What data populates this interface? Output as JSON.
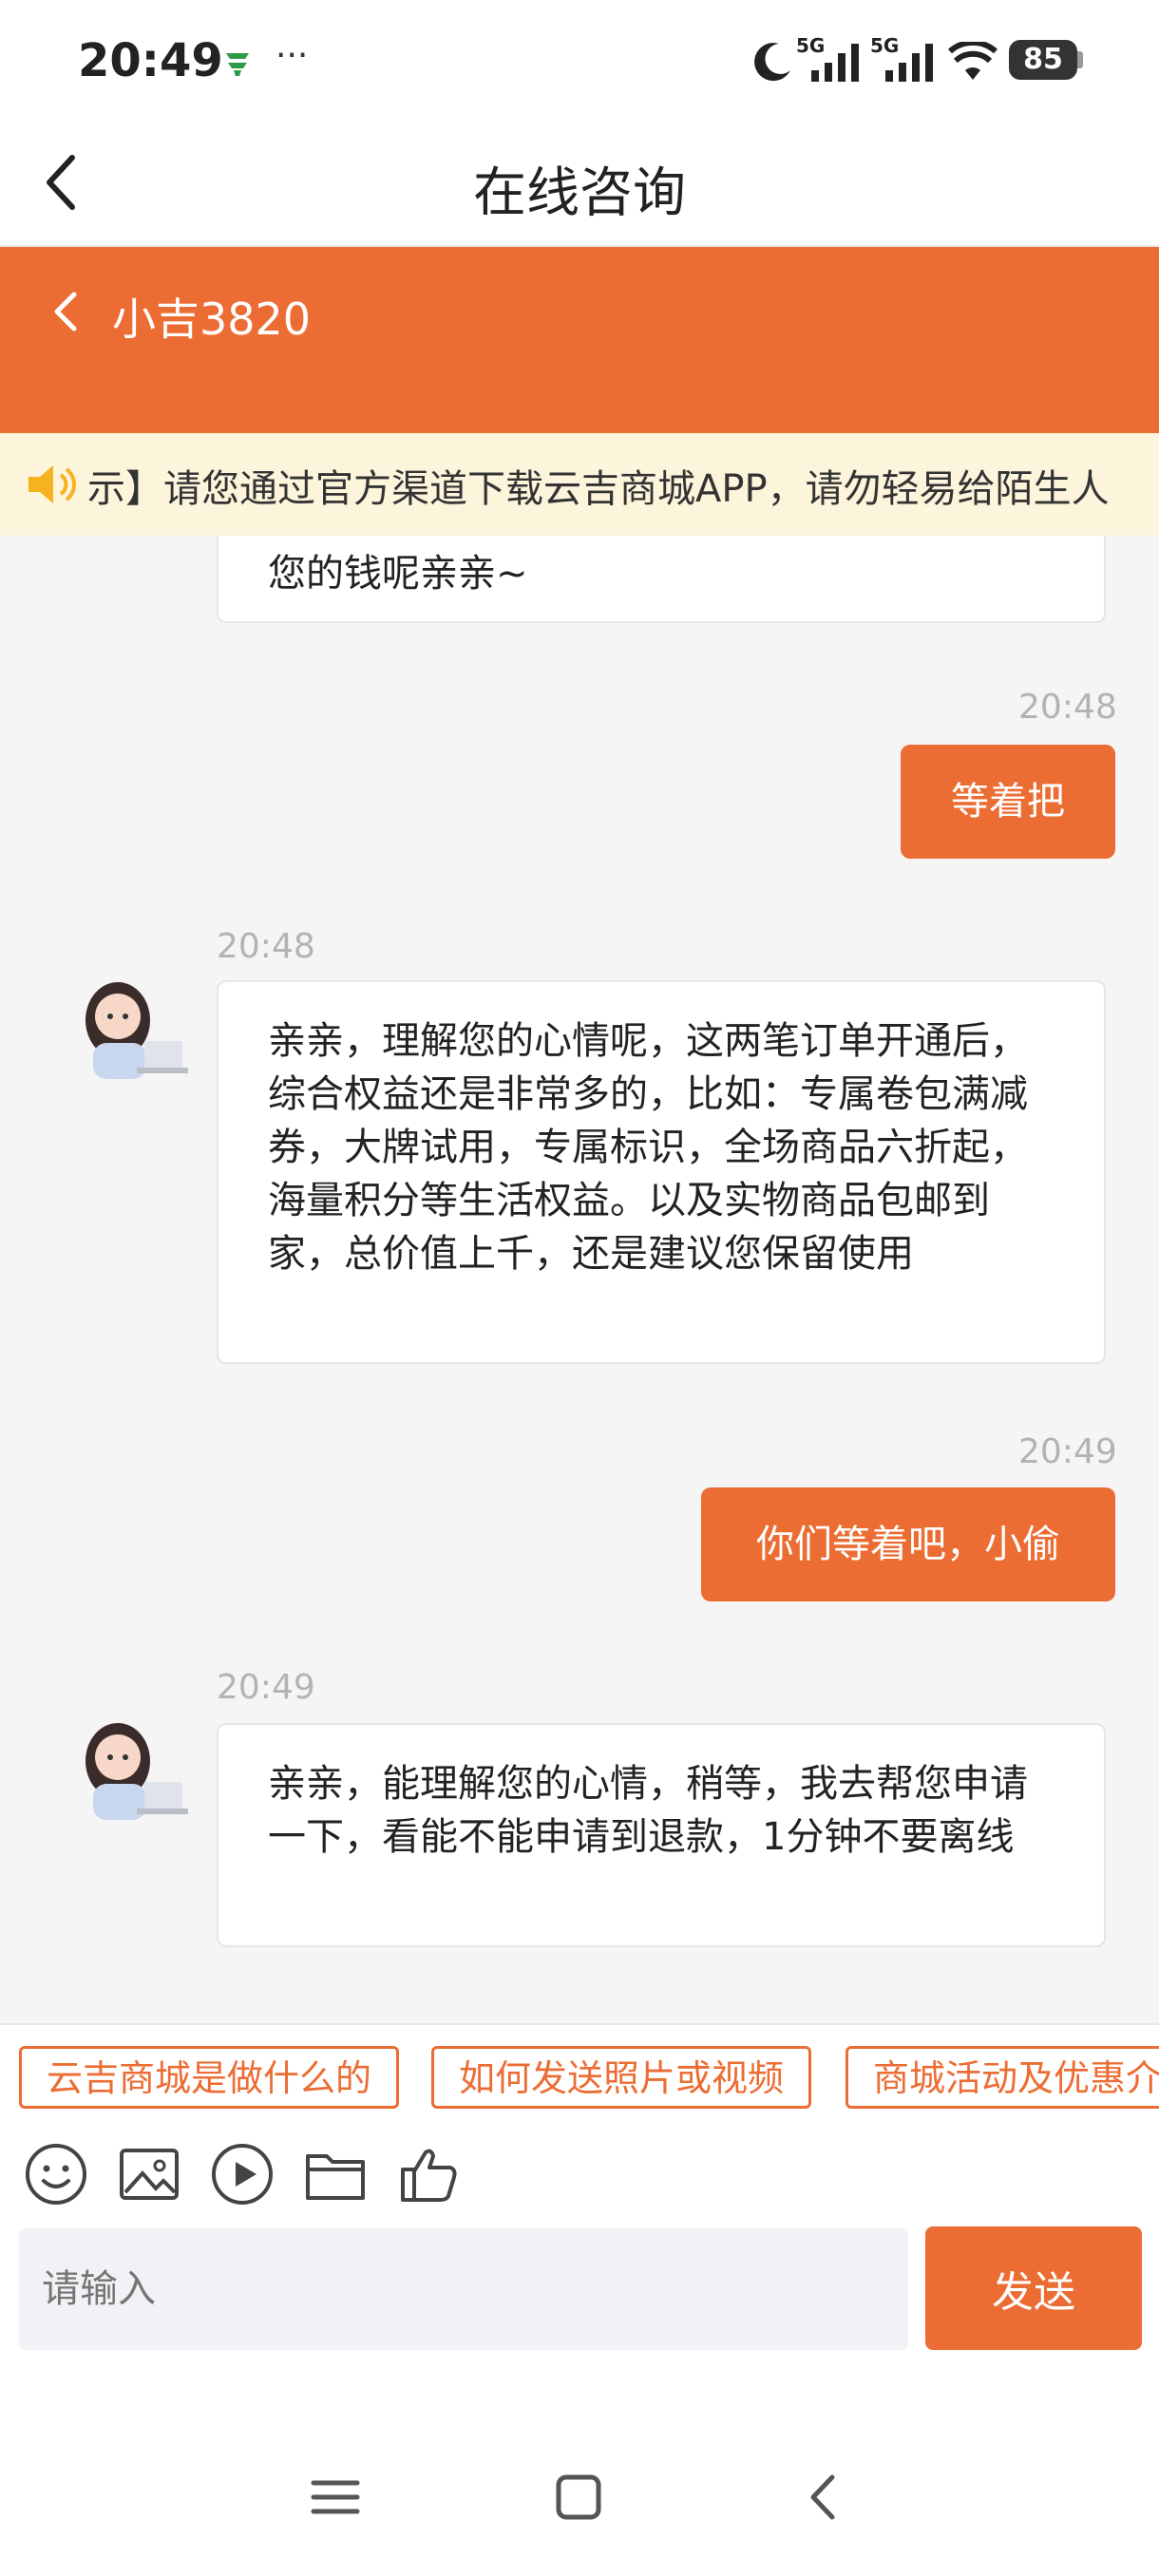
{
  "status": {
    "time": "20:49",
    "more": "···",
    "battery": "85",
    "net1": "5G",
    "net2": "5G"
  },
  "nav": {
    "title": "在线咨询"
  },
  "agent": {
    "name": "小吉3820"
  },
  "notice": {
    "text": "示】请您通过官方渠道下载云吉商城APP，请勿轻易给陌生人"
  },
  "messages": {
    "m0": {
      "text": "您的钱呢亲亲~"
    },
    "m1": {
      "time": "20:48",
      "text": "等着把"
    },
    "m2": {
      "time": "20:48",
      "text": "亲亲，理解您的心情呢，这两笔订单开通后，综合权益还是非常多的，比如：专属卷包满减券，大牌试用，专属标识，全场商品六折起，海量积分等生活权益。以及实物商品包邮到家，总价值上千，还是建议您保留使用"
    },
    "m3": {
      "time": "20:49",
      "text": "你们等着吧，小偷"
    },
    "m4": {
      "time": "20:49",
      "text": "亲亲，能理解您的心情，稍等，我去帮您申请一下，看能不能申请到退款，1分钟不要离线"
    }
  },
  "quick_replies": [
    "云吉商城是做什么的",
    "如何发送照片或视频",
    "商城活动及优惠介绍"
  ],
  "input": {
    "placeholder": "请输入",
    "send_label": "发送"
  },
  "colors": {
    "accent": "#ec6d34",
    "notice_bg": "#fdf4dc"
  }
}
